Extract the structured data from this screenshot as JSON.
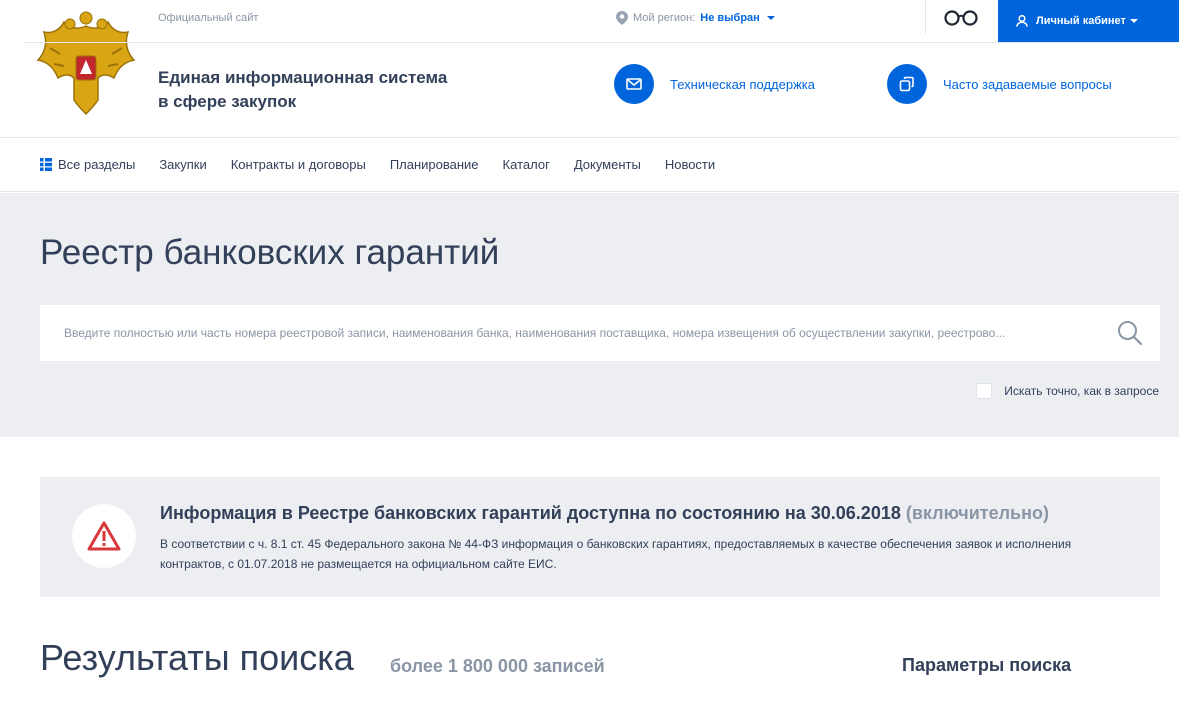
{
  "header": {
    "official_label": "Официальный сайт",
    "region_label": "Мой регион:",
    "region_value": "Не выбран",
    "cabinet_label": "Личный кабинет",
    "site_name_line1": "Единая информационная система",
    "site_name_line2": "в сфере закупок",
    "support_label": "Техническая поддержка",
    "faq_label": "Часто задаваемые вопросы"
  },
  "nav": {
    "items": [
      "Все разделы",
      "Закупки",
      "Контракты и договоры",
      "Планирование",
      "Каталог",
      "Документы",
      "Новости"
    ]
  },
  "search": {
    "page_title": "Реестр банковских гарантий",
    "placeholder": "Введите полностью или часть номера реестровой записи, наименования банка, наименования поставщика, номера извещения об осуществлении закупки, реестрово...",
    "exact_label": "Искать точно, как в запросе"
  },
  "info": {
    "title_main": "Информация в Реестре банковских гарантий доступна по состоянию на 30.06.2018",
    "title_suffix": "(включительно)",
    "text": "В соответствии с ч. 8.1 ст. 45 Федерального закона № 44-ФЗ информация о банковских гарантиях, предоставляемых в качестве обеспечения заявок и исполнения контрактов, с 01.07.2018 не размещается на официальном сайте ЕИС."
  },
  "results": {
    "title": "Результаты поиска",
    "count": "более 1 800 000 записей",
    "params_label": "Параметры поиска"
  },
  "colors": {
    "accent": "#0065dd",
    "text": "#334059",
    "muted": "#8a95a5",
    "panel_bg": "#eceef2",
    "warning": "#d9363e"
  }
}
